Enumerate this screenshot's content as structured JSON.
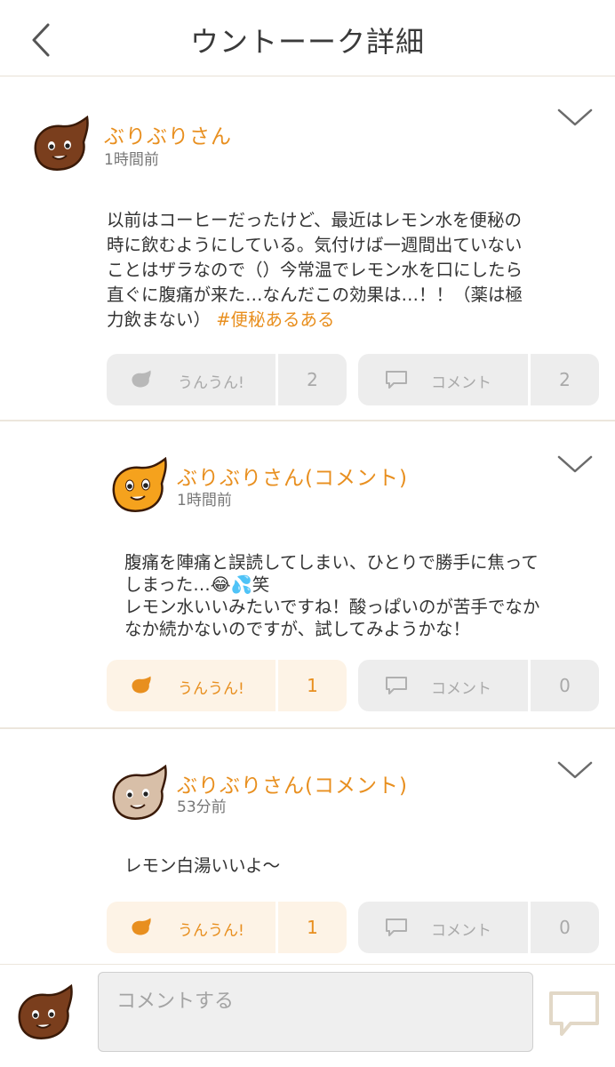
{
  "header": {
    "title": "ウントーーク詳細"
  },
  "posts": [
    {
      "username": "ぶりぶりさん",
      "time": "1時間前",
      "lines": [
        "以前はコーヒーだったけど、最近はレモン水を便秘の",
        "時に飲むようにしている。気付けば一週間出ていない",
        "ことはザラなので（）今常温でレモン水を口にしたら",
        "直ぐに腹痛が来た…なんだこの効果は…！！（薬は極",
        "力飲まない）"
      ],
      "hashtag": "#便秘あるある",
      "unun_label": "うんうん!",
      "unun_count": "2",
      "comment_label": "コメント",
      "comment_count": "2"
    },
    {
      "username": "ぶりぶりさん(コメント)",
      "time": "1時間前",
      "lines": [
        "腹痛を陣痛と誤読してしまい、ひとりで勝手に焦って",
        "しまった…😂💦笑",
        "レモン水いいみたいですね！酸っぱいのが苦手でなか",
        "なか続かないのですが、試してみようかな！"
      ],
      "unun_label": "うんうん!",
      "unun_count": "1",
      "comment_label": "コメント",
      "comment_count": "0"
    },
    {
      "username": "ぶりぶりさん(コメント)",
      "time": "53分前",
      "lines": [
        "レモン白湯いいよ〜"
      ],
      "unun_label": "うんうん!",
      "unun_count": "1",
      "comment_label": "コメント",
      "comment_count": "0"
    }
  ],
  "comment_bar": {
    "placeholder": "コメントする"
  },
  "icons": {
    "back": "chevron-left-icon",
    "menu": "chevron-down-icon",
    "unun": "poop-blob-icon",
    "comment": "speech-bubble-icon",
    "send": "send-comment-icon"
  },
  "colors": {
    "accent": "#e88f1f",
    "avatar_brown": "#7a3e1d",
    "avatar_orange": "#f5a21d",
    "avatar_beige": "#d8bfa8",
    "inactive": "#a9a9a9",
    "active_bg": "#fdf3e6"
  }
}
